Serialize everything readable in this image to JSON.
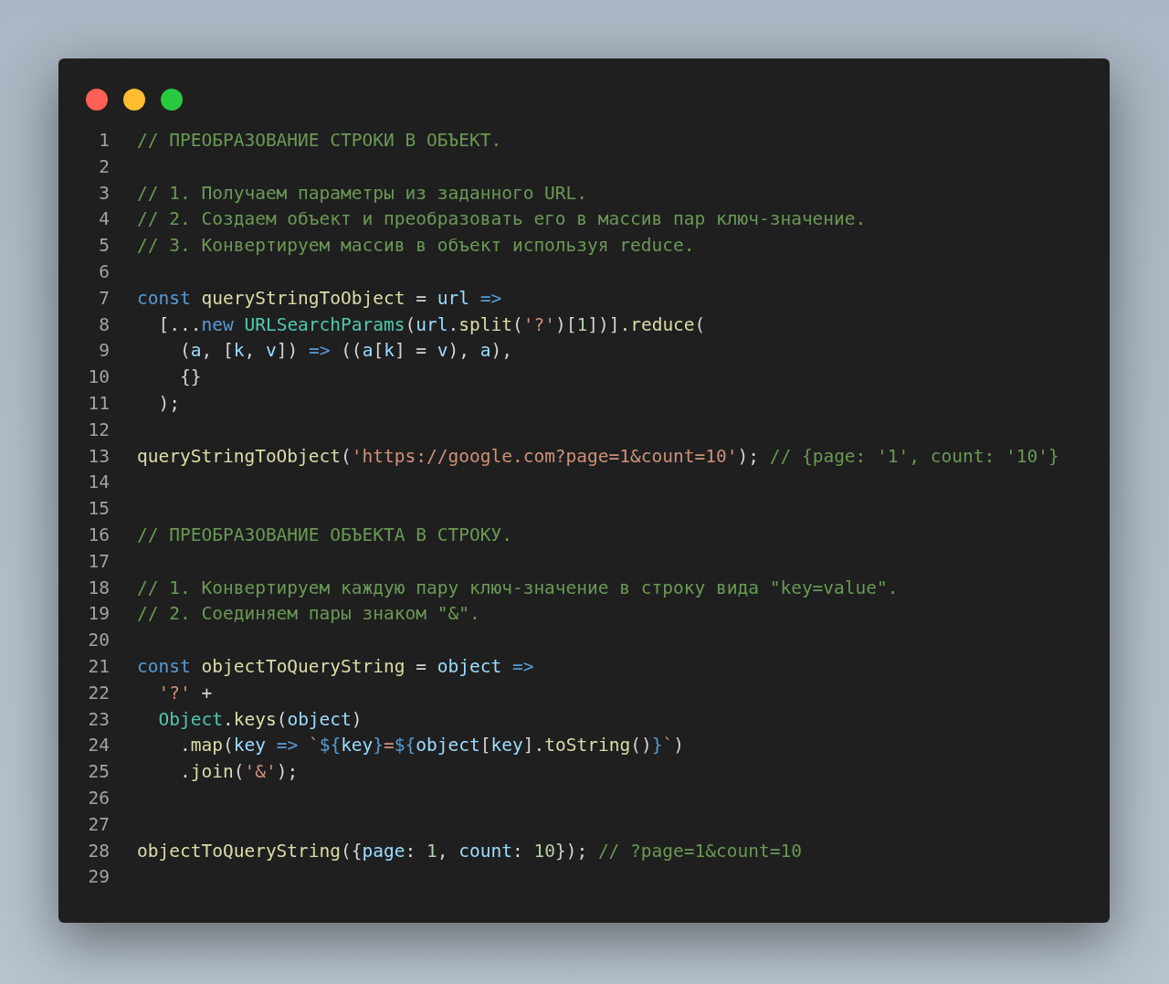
{
  "window_controls": [
    {
      "color": "#fe5f57"
    },
    {
      "color": "#febc2e"
    },
    {
      "color": "#28c840"
    }
  ],
  "lines": [
    {
      "number": "1",
      "tokens": [
        {
          "text": "// ПРЕОБРАЗОВАНИЕ СТРОКИ В ОБЪЕКТ.",
          "kind": "comment"
        }
      ]
    },
    {
      "number": "2"
    },
    {
      "number": "3",
      "tokens": [
        {
          "text": "// 1. Получаем параметры из заданного URL.",
          "kind": "comment"
        }
      ]
    },
    {
      "number": "4",
      "tokens": [
        {
          "text": "// 2. Создаем объект и преобразовать его в массив пар ключ-значение.",
          "kind": "comment"
        }
      ]
    },
    {
      "number": "5",
      "tokens": [
        {
          "text": "// 3. Конвертируем массив в объект используя reduce.",
          "kind": "comment"
        }
      ]
    },
    {
      "number": "6"
    },
    {
      "number": "7",
      "tokens": [
        {
          "text": "const ",
          "kind": "keyword"
        },
        {
          "text": "queryStringToObject",
          "kind": "function"
        },
        {
          "text": " = ",
          "kind": "plain"
        },
        {
          "text": "url ",
          "kind": "variable"
        },
        {
          "text": "=>",
          "kind": "keyword"
        }
      ]
    },
    {
      "number": "8",
      "tokens": [
        {
          "text": "  [...",
          "kind": "plain"
        },
        {
          "text": "new ",
          "kind": "keyword"
        },
        {
          "text": "URLSearchParams",
          "kind": "class"
        },
        {
          "text": "(",
          "kind": "plain"
        },
        {
          "text": "url",
          "kind": "variable"
        },
        {
          "text": ".",
          "kind": "plain"
        },
        {
          "text": "split",
          "kind": "function"
        },
        {
          "text": "(",
          "kind": "plain"
        },
        {
          "text": "'?'",
          "kind": "string"
        },
        {
          "text": ")[",
          "kind": "plain"
        },
        {
          "text": "1",
          "kind": "number"
        },
        {
          "text": "])].",
          "kind": "plain"
        },
        {
          "text": "reduce",
          "kind": "function"
        },
        {
          "text": "(",
          "kind": "plain"
        }
      ]
    },
    {
      "number": "9",
      "tokens": [
        {
          "text": "    (",
          "kind": "plain"
        },
        {
          "text": "a",
          "kind": "variable"
        },
        {
          "text": ", [",
          "kind": "plain"
        },
        {
          "text": "k",
          "kind": "variable"
        },
        {
          "text": ", ",
          "kind": "plain"
        },
        {
          "text": "v",
          "kind": "variable"
        },
        {
          "text": "]) ",
          "kind": "plain"
        },
        {
          "text": "=>",
          "kind": "keyword"
        },
        {
          "text": " ((",
          "kind": "plain"
        },
        {
          "text": "a",
          "kind": "variable"
        },
        {
          "text": "[",
          "kind": "plain"
        },
        {
          "text": "k",
          "kind": "variable"
        },
        {
          "text": "] = ",
          "kind": "plain"
        },
        {
          "text": "v",
          "kind": "variable"
        },
        {
          "text": "), ",
          "kind": "plain"
        },
        {
          "text": "a",
          "kind": "variable"
        },
        {
          "text": "),",
          "kind": "plain"
        }
      ]
    },
    {
      "number": "10",
      "tokens": [
        {
          "text": "    {}",
          "kind": "plain"
        }
      ]
    },
    {
      "number": "11",
      "tokens": [
        {
          "text": "  );",
          "kind": "plain"
        }
      ]
    },
    {
      "number": "12"
    },
    {
      "number": "13",
      "tokens": [
        {
          "text": "queryStringToObject",
          "kind": "function"
        },
        {
          "text": "(",
          "kind": "plain"
        },
        {
          "text": "'https://google.com?page=1&count=10'",
          "kind": "string"
        },
        {
          "text": "); ",
          "kind": "plain"
        },
        {
          "text": "// {page: '1', count: '10'}",
          "kind": "comment"
        }
      ]
    },
    {
      "number": "14"
    },
    {
      "number": "15"
    },
    {
      "number": "16",
      "tokens": [
        {
          "text": "// ПРЕОБРАЗОВАНИЕ ОБЪЕКТА В СТРОКУ.",
          "kind": "comment"
        }
      ]
    },
    {
      "number": "17"
    },
    {
      "number": "18",
      "tokens": [
        {
          "text": "// 1. Конвертируем каждую пару ключ-значение в строку вида \"key=value\".",
          "kind": "comment"
        }
      ]
    },
    {
      "number": "19",
      "tokens": [
        {
          "text": "// 2. Соединяем пары знаком \"&\".",
          "kind": "comment"
        }
      ]
    },
    {
      "number": "20"
    },
    {
      "number": "21",
      "tokens": [
        {
          "text": "const ",
          "kind": "keyword"
        },
        {
          "text": "objectToQueryString",
          "kind": "function"
        },
        {
          "text": " = ",
          "kind": "plain"
        },
        {
          "text": "object ",
          "kind": "variable"
        },
        {
          "text": "=>",
          "kind": "keyword"
        }
      ]
    },
    {
      "number": "22",
      "tokens": [
        {
          "text": "  '?'",
          "kind": "string"
        },
        {
          "text": " +",
          "kind": "plain"
        }
      ]
    },
    {
      "number": "23",
      "tokens": [
        {
          "text": "  Object",
          "kind": "class"
        },
        {
          "text": ".",
          "kind": "plain"
        },
        {
          "text": "keys",
          "kind": "function"
        },
        {
          "text": "(",
          "kind": "plain"
        },
        {
          "text": "object",
          "kind": "variable"
        },
        {
          "text": ")",
          "kind": "plain"
        }
      ]
    },
    {
      "number": "24",
      "tokens": [
        {
          "text": "    .",
          "kind": "plain"
        },
        {
          "text": "map",
          "kind": "function"
        },
        {
          "text": "(",
          "kind": "plain"
        },
        {
          "text": "key ",
          "kind": "variable"
        },
        {
          "text": "=> ",
          "kind": "keyword"
        },
        {
          "text": "`",
          "kind": "string"
        },
        {
          "text": "${",
          "kind": "keyword"
        },
        {
          "text": "key",
          "kind": "variable"
        },
        {
          "text": "}",
          "kind": "keyword"
        },
        {
          "text": "=",
          "kind": "string"
        },
        {
          "text": "${",
          "kind": "keyword"
        },
        {
          "text": "object",
          "kind": "variable"
        },
        {
          "text": "[",
          "kind": "plain"
        },
        {
          "text": "key",
          "kind": "variable"
        },
        {
          "text": "].",
          "kind": "plain"
        },
        {
          "text": "toString",
          "kind": "function"
        },
        {
          "text": "()",
          "kind": "plain"
        },
        {
          "text": "}",
          "kind": "keyword"
        },
        {
          "text": "`",
          "kind": "string"
        },
        {
          "text": ")",
          "kind": "plain"
        }
      ]
    },
    {
      "number": "25",
      "tokens": [
        {
          "text": "    .",
          "kind": "plain"
        },
        {
          "text": "join",
          "kind": "function"
        },
        {
          "text": "(",
          "kind": "plain"
        },
        {
          "text": "'&'",
          "kind": "string"
        },
        {
          "text": ");",
          "kind": "plain"
        }
      ]
    },
    {
      "number": "26"
    },
    {
      "number": "27"
    },
    {
      "number": "28",
      "tokens": [
        {
          "text": "objectToQueryString",
          "kind": "function"
        },
        {
          "text": "({",
          "kind": "plain"
        },
        {
          "text": "page",
          "kind": "variable"
        },
        {
          "text": ": ",
          "kind": "plain"
        },
        {
          "text": "1",
          "kind": "number"
        },
        {
          "text": ", ",
          "kind": "plain"
        },
        {
          "text": "count",
          "kind": "variable"
        },
        {
          "text": ": ",
          "kind": "plain"
        },
        {
          "text": "10",
          "kind": "number"
        },
        {
          "text": "}); ",
          "kind": "plain"
        },
        {
          "text": "// ?page=1&count=10",
          "kind": "comment"
        }
      ]
    },
    {
      "number": "29"
    }
  ]
}
